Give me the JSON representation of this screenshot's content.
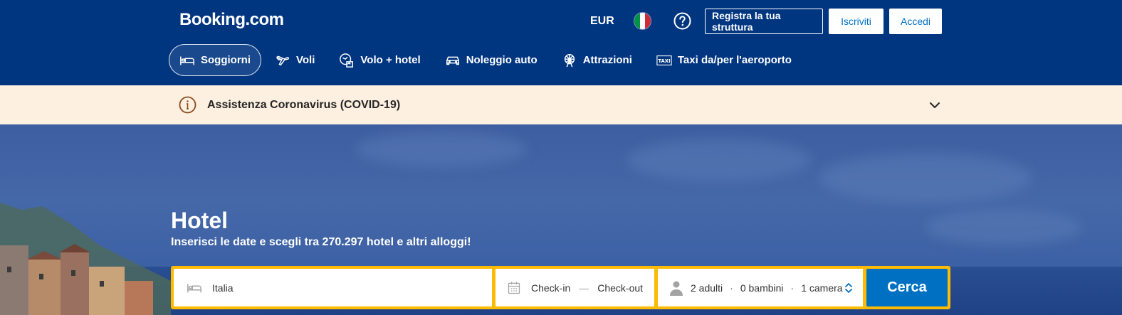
{
  "header": {
    "logo": "Booking.com",
    "currency": "EUR",
    "flag_colors": [
      "#009246",
      "#ffffff",
      "#ce2b37"
    ],
    "help_icon": "question-circle-icon",
    "list_property_label": "Registra la tua struttura",
    "register_label": "Iscriviti",
    "login_label": "Accedi"
  },
  "nav": {
    "items": [
      {
        "label": "Soggiorni",
        "icon": "bed-icon",
        "active": true
      },
      {
        "label": "Voli",
        "icon": "plane-icon",
        "active": false
      },
      {
        "label": "Volo + hotel",
        "icon": "flight-hotel-icon",
        "active": false
      },
      {
        "label": "Noleggio auto",
        "icon": "car-icon",
        "active": false
      },
      {
        "label": "Attrazioni",
        "icon": "ferris-wheel-icon",
        "active": false
      },
      {
        "label": "Taxi da/per l'aeroporto",
        "icon": "taxi-icon",
        "active": false
      }
    ]
  },
  "banner": {
    "text": "Assistenza Coronavirus (COVID-19)",
    "icon": "info-icon",
    "bg_color": "#fdf0e1"
  },
  "hero": {
    "title": "Hotel",
    "subtitle": "Inserisci le date e scegli tra 270.297 hotel e altri alloggi!"
  },
  "search": {
    "destination_value": "Italia",
    "checkin_label": "Check-in",
    "date_separator": "—",
    "checkout_label": "Check-out",
    "adults": "2 adulti",
    "children": "0 bambini",
    "rooms": "1 camera",
    "separator": "·",
    "submit_label": "Cerca",
    "accent_color": "#febb02",
    "button_color": "#0071c2"
  }
}
